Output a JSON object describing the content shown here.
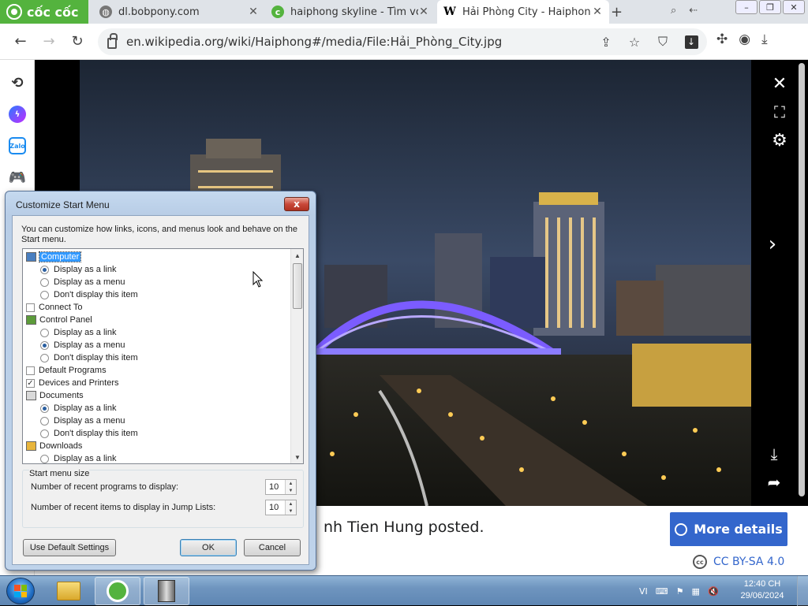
{
  "browser": {
    "brand": "cốc cốc",
    "tabs": [
      {
        "title": "dl.bobpony.com",
        "favicon": "globe-icon"
      },
      {
        "title": "haiphong skyline - Tìm vớ",
        "favicon": "coccoc-search-icon"
      },
      {
        "title": "Hải Phòng City - Haiphon",
        "favicon": "wikipedia-icon"
      }
    ],
    "url": "en.wikipedia.org/wiki/Haiphong#/media/File:Hải_Phòng_City.jpg"
  },
  "viewer": {
    "poster_text": "nh Tien Hung posted.",
    "more_details_label": "More details",
    "license_label": "CC BY-SA 4.0",
    "license_badge": "cc"
  },
  "dialog": {
    "title": "Customize Start Menu",
    "close_glyph": "x",
    "description": "You can customize how links, icons, and menus look and behave on the Start menu.",
    "items": [
      {
        "kind": "header",
        "icon": "computer-icon",
        "label": "Computer",
        "selected": true
      },
      {
        "kind": "radio",
        "label": "Display as a link",
        "checked": true
      },
      {
        "kind": "radio",
        "label": "Display as a menu",
        "checked": false
      },
      {
        "kind": "radio",
        "label": "Don't display this item",
        "checked": false
      },
      {
        "kind": "check",
        "label": "Connect To",
        "checked": false
      },
      {
        "kind": "header",
        "icon": "control-panel-icon",
        "label": "Control Panel"
      },
      {
        "kind": "radio",
        "label": "Display as a link",
        "checked": false
      },
      {
        "kind": "radio",
        "label": "Display as a menu",
        "checked": true
      },
      {
        "kind": "radio",
        "label": "Don't display this item",
        "checked": false
      },
      {
        "kind": "check",
        "label": "Default Programs",
        "checked": false
      },
      {
        "kind": "check",
        "label": "Devices and Printers",
        "checked": true
      },
      {
        "kind": "header",
        "icon": "documents-icon",
        "label": "Documents"
      },
      {
        "kind": "radio",
        "label": "Display as a link",
        "checked": true
      },
      {
        "kind": "radio",
        "label": "Display as a menu",
        "checked": false
      },
      {
        "kind": "radio",
        "label": "Don't display this item",
        "checked": false
      },
      {
        "kind": "header",
        "icon": "downloads-icon",
        "label": "Downloads"
      },
      {
        "kind": "radio",
        "label": "Display as a link",
        "checked": false
      }
    ],
    "size_group_label": "Start menu size",
    "recent_programs_label": "Number of recent programs to display:",
    "recent_programs_value": "10",
    "recent_items_label": "Number of recent items to display in Jump Lists:",
    "recent_items_value": "10",
    "default_settings_label": "Use Default Settings",
    "ok_label": "OK",
    "cancel_label": "Cancel"
  },
  "taskbar": {
    "apps": [
      "explorer-icon",
      "coccoc-browser-icon",
      "system-tool-icon"
    ],
    "language": "VI",
    "time": "12:40 CH",
    "date": "29/06/2024"
  },
  "colors": {
    "brand_green": "#54b33e",
    "wiki_blue": "#3366cc",
    "selection_blue": "#3399ff"
  }
}
